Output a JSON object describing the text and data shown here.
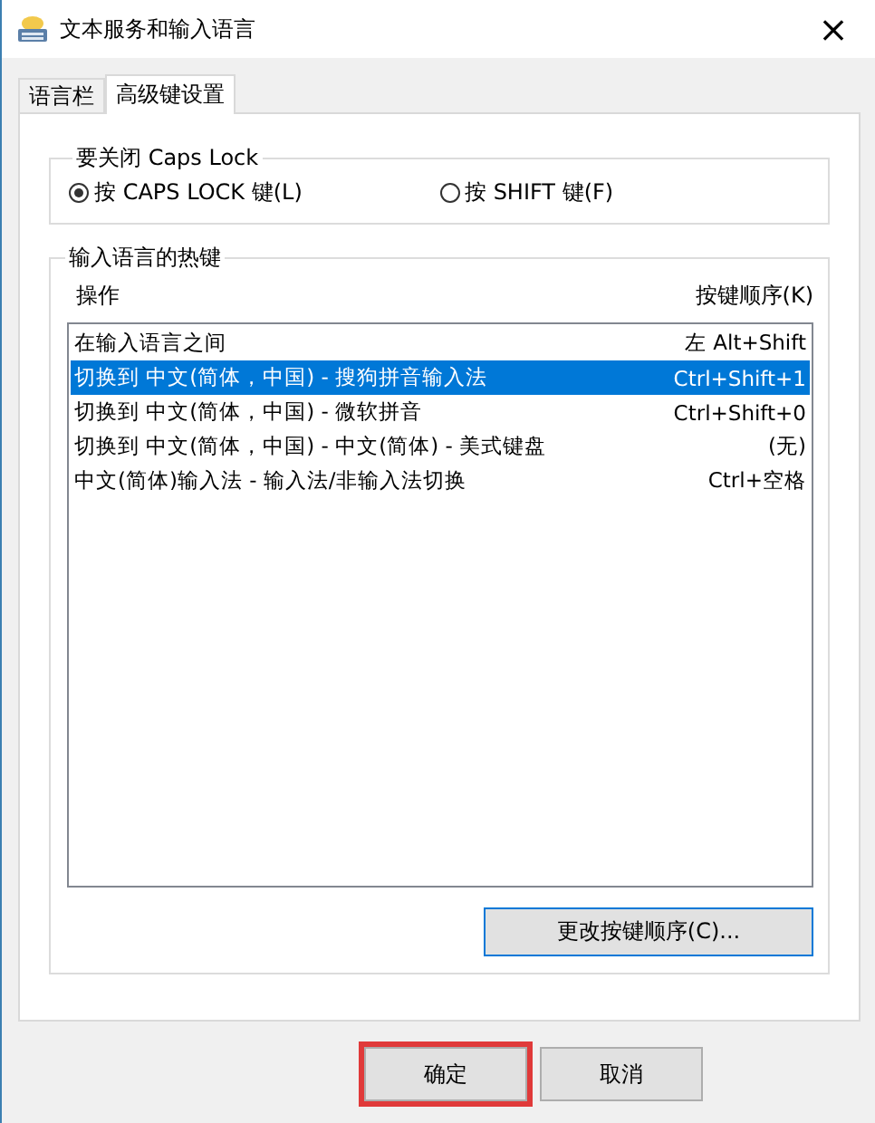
{
  "window": {
    "title": "文本服务和输入语言",
    "close": "×"
  },
  "tabs": [
    {
      "label": "语言栏",
      "selected": false
    },
    {
      "label": "高级键设置",
      "selected": true
    }
  ],
  "caps_lock_group": {
    "title": "要关闭 Caps Lock",
    "options": [
      {
        "label": "按 CAPS LOCK 键(L)",
        "selected": true
      },
      {
        "label": "按 SHIFT 键(F)",
        "selected": false
      }
    ]
  },
  "hotkeys_group": {
    "title": "输入语言的热键",
    "columns": [
      "操作",
      "按键顺序(K)"
    ],
    "rows": [
      {
        "action": "在输入语言之间",
        "keys": "左 Alt+Shift",
        "selected": false
      },
      {
        "action": "切换到 中文(简体，中国) - 搜狗拼音输入法",
        "keys": "Ctrl+Shift+1",
        "selected": true
      },
      {
        "action": "切换到 中文(简体，中国) - 微软拼音",
        "keys": "Ctrl+Shift+0",
        "selected": false
      },
      {
        "action": "切换到 中文(简体，中国) - 中文(简体) - 美式键盘",
        "keys": "(无)",
        "selected": false
      },
      {
        "action": "中文(简体)输入法 - 输入法/非输入法切换",
        "keys": "Ctrl+空格",
        "selected": false
      }
    ],
    "change_button": "更改按键顺序(C)..."
  },
  "buttons": [
    {
      "label": "确定",
      "highlighted": true
    },
    {
      "label": "取消",
      "highlighted": false
    }
  ]
}
